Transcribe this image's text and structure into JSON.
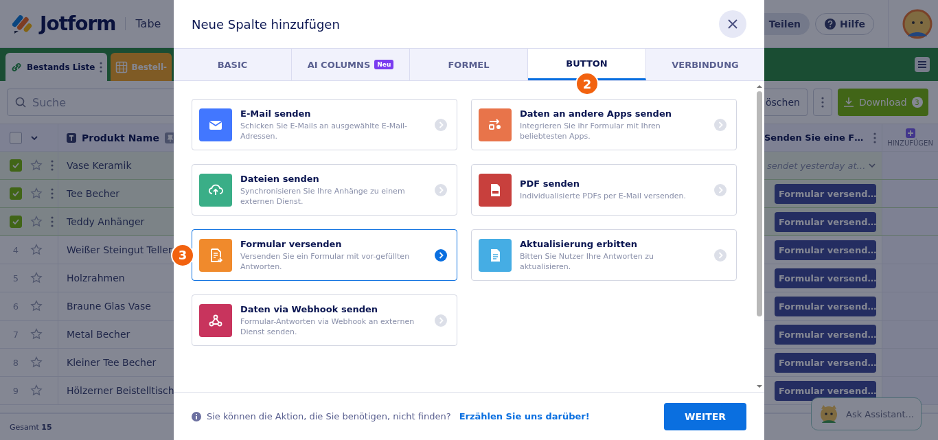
{
  "app": {
    "logo": "Jotform",
    "title": "Tabe",
    "share": "Teilen",
    "help": "Hilfe"
  },
  "sheet_tabs": [
    {
      "label": "Bestands Liste",
      "selected": true
    },
    {
      "label": "Bestell-",
      "selected": false
    }
  ],
  "toolbar": {
    "search_placeholder": "Suche",
    "delete": "öschen",
    "download": "Download",
    "download_count": "3"
  },
  "grid": {
    "name_column": "Produkt Name",
    "action_column": "Senden Sie eine F…",
    "add_column": "HINZUFÜGEN",
    "all_checked": false,
    "rows": [
      {
        "name": "Vase Keramik",
        "checked": true,
        "action": "sendet yesterday at…",
        "kind": "status"
      },
      {
        "name": "Tee Becher",
        "checked": true,
        "action": "Formular versend…",
        "kind": "button"
      },
      {
        "name": "Teddy Anhänger",
        "checked": true,
        "action": "Formular versend…",
        "kind": "button"
      },
      {
        "number": "4",
        "name": "Weißer Steingut Teller",
        "checked": false,
        "action": "Formular versend…",
        "kind": "button"
      },
      {
        "number": "5",
        "name": "Holzrahmen",
        "checked": false,
        "action": "Formular versend…",
        "kind": "button"
      },
      {
        "number": "6",
        "name": "Braune Glas Vase",
        "checked": false,
        "action": "Formular versend…",
        "kind": "button"
      },
      {
        "number": "7",
        "name": "Metal Becher",
        "checked": false,
        "action": "Formular versend…",
        "kind": "button"
      },
      {
        "number": "8",
        "name": "Kleiner Tee Becher",
        "checked": false,
        "action": "Formular versend…",
        "kind": "button"
      },
      {
        "number": "9",
        "name": "Hölzerner Beistelltisch",
        "checked": false,
        "action": "Formular versend…",
        "kind": "button"
      }
    ],
    "total_label": "Gesamt",
    "total": "15"
  },
  "assistant": {
    "label": "Ask Assistant..."
  },
  "dialog": {
    "title": "Neue Spalte hinzufügen",
    "tabs": [
      {
        "label": "BASIC",
        "selected": false
      },
      {
        "label": "AI COLUMNS",
        "badge": "Neu",
        "selected": false
      },
      {
        "label": "FORMEL",
        "selected": false
      },
      {
        "label": "BUTTON",
        "selected": true,
        "step": "2"
      },
      {
        "label": "VERBINDUNG",
        "selected": false
      }
    ],
    "actions": [
      {
        "title": "E-Mail senden",
        "description": "Schicken Sie E-Mails an ausgewählte E-Mail-Adressen.",
        "kind": "email",
        "color": "#4277ff",
        "selected": false
      },
      {
        "title": "Daten an andere Apps senden",
        "description": "Integrieren Sie ihr Formular mit Ihren beliebtesten Apps.",
        "kind": "apps",
        "color": "#e8744a",
        "selected": false
      },
      {
        "title": "Dateien senden",
        "description": "Synchronisieren Sie Ihre Anhänge zu einem externen Dienst.",
        "kind": "files",
        "color": "#3aae87",
        "selected": false
      },
      {
        "title": "PDF senden",
        "description": "Individualisierte PDFs per E-Mail versenden.",
        "kind": "pdf",
        "color": "#c8403d",
        "selected": false
      },
      {
        "title": "Formular versenden",
        "description": "Versenden Sie ein Formular mit vor-gefüllten Antworten.",
        "kind": "form",
        "color": "#f08a2c",
        "selected": true,
        "step": "3"
      },
      {
        "title": "Aktualisierung erbitten",
        "description": "Bitten Sie Nutzer Ihre Antworten zu aktualisieren.",
        "kind": "update",
        "color": "#45ade4",
        "selected": false
      },
      {
        "title": "Daten via Webhook senden",
        "description": "Formular-Antworten via Webhook an externen Dienst senden.",
        "kind": "webhook",
        "color": "#c8345d",
        "selected": false
      }
    ],
    "footer_text": "Sie können die Aktion, die Sie benötigen, nicht finden?",
    "footer_link": "Erzählen Sie uns darüber!",
    "primary": "WEITER"
  }
}
